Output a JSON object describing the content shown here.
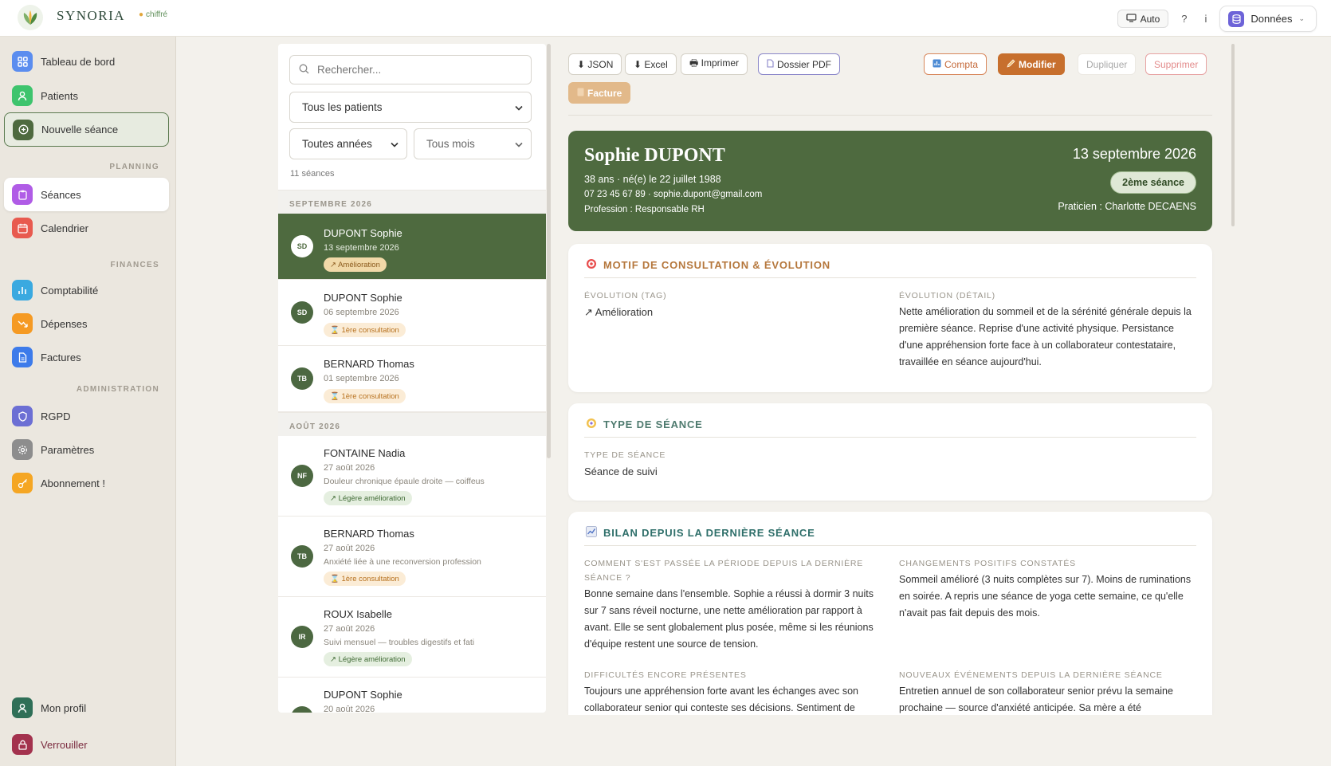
{
  "topbar": {
    "brand": "SYNORIA",
    "encrypted_label": "chiffré",
    "theme_label": "Auto",
    "help_label": "?",
    "info_label": "i",
    "data_label": "Données"
  },
  "sidebar": {
    "items": [
      {
        "label": "Tableau de bord",
        "icon": "grid-icon",
        "color": "#5b8def"
      },
      {
        "label": "Patients",
        "icon": "user-icon",
        "color": "#3ec46d"
      },
      {
        "label": "Nouvelle séance",
        "icon": "plus-circle-icon",
        "color": "#4e6a3f"
      },
      {
        "label": "Séances",
        "icon": "clipboard-icon",
        "color": "#b05ce6"
      },
      {
        "label": "Calendrier",
        "icon": "calendar-icon",
        "color": "#e85a4f"
      },
      {
        "label": "Comptabilité",
        "icon": "bar-chart-icon",
        "color": "#3aa9e0"
      },
      {
        "label": "Dépenses",
        "icon": "trend-down-icon",
        "color": "#f59a23"
      },
      {
        "label": "Factures",
        "icon": "document-icon",
        "color": "#3d7bea"
      },
      {
        "label": "RGPD",
        "icon": "shield-icon",
        "color": "#6c6fd4"
      },
      {
        "label": "Paramètres",
        "icon": "gear-icon",
        "color": "#8d8d8d"
      },
      {
        "label": "Abonnement !",
        "icon": "key-icon",
        "color": "#f5a623"
      },
      {
        "label": "Mon profil",
        "icon": "profile-icon",
        "color": "#2f6f57"
      },
      {
        "label": "Verrouiller",
        "icon": "lock-icon",
        "color": "#a3324e"
      }
    ],
    "sections": {
      "planning": "PLANNING",
      "finances": "FINANCES",
      "administration": "ADMINISTRATION"
    }
  },
  "list": {
    "search_placeholder": "Rechercher...",
    "patient_filter": "Tous les patients",
    "year_filter": "Toutes années",
    "month_filter": "Tous mois",
    "count": "11 séances",
    "groups": [
      "SEPTEMBRE 2026",
      "AOÛT 2026"
    ],
    "items": [
      {
        "initials": "SD",
        "name": "DUPONT Sophie",
        "date": "13 septembre 2026",
        "desc": "",
        "tag": "↗ Amélioration"
      },
      {
        "initials": "SD",
        "name": "DUPONT Sophie",
        "date": "06 septembre 2026",
        "desc": "",
        "tag": "⌛ 1ère consultation"
      },
      {
        "initials": "TB",
        "name": "BERNARD Thomas",
        "date": "01 septembre 2026",
        "desc": "",
        "tag": "⌛ 1ère consultation"
      },
      {
        "initials": "NF",
        "name": "FONTAINE Nadia",
        "date": "27 août 2026",
        "desc": "Douleur chronique épaule droite — coiffeus",
        "tag": "↗ Légère amélioration"
      },
      {
        "initials": "TB",
        "name": "BERNARD Thomas",
        "date": "27 août 2026",
        "desc": "Anxiété liée à une reconversion profession",
        "tag": "⌛ 1ère consultation"
      },
      {
        "initials": "IR",
        "name": "ROUX Isabelle",
        "date": "27 août 2026",
        "desc": "Suivi mensuel — troubles digestifs et fati",
        "tag": "↗ Légère amélioration"
      },
      {
        "initials": "SD",
        "name": "DUPONT Sophie",
        "date": "20 août 2026",
        "desc": "",
        "tag": ""
      }
    ]
  },
  "toolbar": {
    "json": "⬇ JSON",
    "excel": "⬇ Excel",
    "print": "🖶 Imprimer",
    "pdf": "Dossier PDF",
    "compta": "Compta",
    "modify": "Modifier",
    "duplicate": "Dupliquer",
    "delete": "Supprimer",
    "invoice": "Facture"
  },
  "header": {
    "name": "Sophie DUPONT",
    "age_birth": "38 ans · né(e) le 22 juillet 1988",
    "contact": "07 23 45 67 89 · sophie.dupont@gmail.com",
    "profession": "Profession : Responsable RH",
    "date": "13 septembre 2026",
    "session_badge": "2ème séance",
    "practitioner": "Praticien : Charlotte DECAENS"
  },
  "motif": {
    "title": "MOTIF DE CONSULTATION & ÉVOLUTION",
    "evo_tag_label": "ÉVOLUTION (TAG)",
    "evo_tag_value": "↗ Amélioration",
    "evo_detail_label": "ÉVOLUTION (DÉTAIL)",
    "evo_detail_value": "Nette amélioration du sommeil et de la sérénité générale depuis la première séance. Reprise d'une activité physique. Persistance d'une appréhension forte face à un collaborateur contestataire, travaillée en séance aujourd'hui."
  },
  "type": {
    "title": "TYPE DE SÉANCE",
    "label": "TYPE DE SÉANCE",
    "value": "Séance de suivi"
  },
  "bilan": {
    "title": "BILAN DEPUIS LA DERNIÈRE SÉANCE",
    "q1_label": "COMMENT S'EST PASSÉE LA PÉRIODE DEPUIS LA DERNIÈRE SÉANCE ?",
    "q1_value": "Bonne semaine dans l'ensemble. Sophie a réussi à dormir 3 nuits sur 7 sans réveil nocturne, une nette amélioration par rapport à avant. Elle se sent globalement plus posée, même si les réunions d'équipe restent une source de tension.",
    "q2_label": "CHANGEMENTS POSITIFS CONSTATÉS",
    "q2_value": "Sommeil amélioré (3 nuits complètes sur 7). Moins de ruminations en soirée. A repris une séance de yoga cette semaine, ce qu'elle n'avait pas fait depuis des mois.",
    "q3_label": "DIFFICULTÉS ENCORE PRÉSENTES",
    "q3_value": "Toujours une appréhension forte avant les échanges avec son collaborateur senior qui conteste ses décisions. Sentiment de",
    "q4_label": "NOUVEAUX ÉVÉNEMENTS DEPUIS LA DERNIÈRE SÉANCE",
    "q4_value": "Entretien annuel de son collaborateur senior prévu la semaine prochaine — source d'anxiété anticipée. Sa mère a été"
  }
}
